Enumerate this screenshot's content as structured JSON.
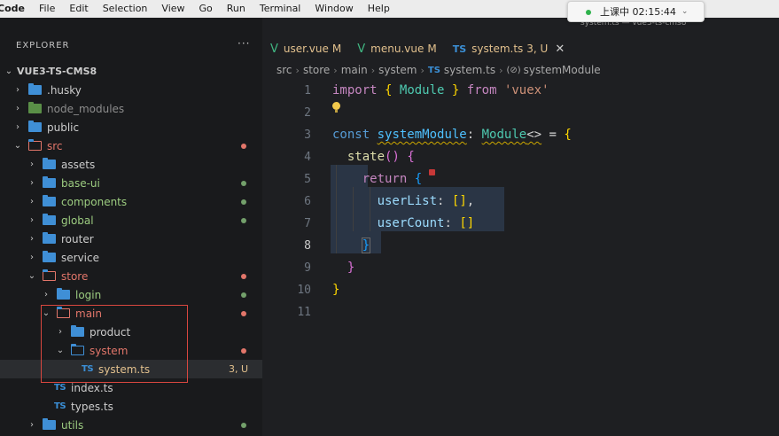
{
  "menubar": {
    "app": "Code",
    "items": [
      "File",
      "Edit",
      "Selection",
      "View",
      "Go",
      "Run",
      "Terminal",
      "Window",
      "Help"
    ]
  },
  "overlay": {
    "text": "上课中 02:15:44"
  },
  "window_title": "system.ts — vue3-ts-cms8",
  "explorer": {
    "header": "EXPLORER",
    "more": "···",
    "root": "VUE3-TS-CMS8",
    "tree": [
      {
        "label": ".husky",
        "status": ""
      },
      {
        "label": "node_modules",
        "status": ""
      },
      {
        "label": "public",
        "status": ""
      },
      {
        "label": "src",
        "status": ""
      },
      {
        "label": "assets",
        "status": ""
      },
      {
        "label": "base-ui",
        "status": ""
      },
      {
        "label": "components",
        "status": ""
      },
      {
        "label": "global",
        "status": ""
      },
      {
        "label": "router",
        "status": ""
      },
      {
        "label": "service",
        "status": ""
      },
      {
        "label": "store",
        "status": ""
      },
      {
        "label": "login",
        "status": ""
      },
      {
        "label": "main",
        "status": ""
      },
      {
        "label": "product",
        "status": ""
      },
      {
        "label": "system",
        "status": ""
      },
      {
        "label": "system.ts",
        "status": "3, U"
      },
      {
        "label": "index.ts",
        "status": ""
      },
      {
        "label": "types.ts",
        "status": ""
      },
      {
        "label": "utils",
        "status": ""
      }
    ],
    "colors": {
      "git_modified": "#e2c08d",
      "git_untracked": "#73c991",
      "git_error": "#e2766a"
    }
  },
  "tabs": [
    {
      "name": "user.vue",
      "flag": "M"
    },
    {
      "name": "menu.vue",
      "flag": "M"
    },
    {
      "name": "system.ts",
      "flag": "3, U"
    }
  ],
  "breadcrumb": [
    "src",
    "store",
    "main",
    "system",
    "system.ts",
    "systemModule"
  ],
  "code": {
    "line_numbers": [
      "1",
      "2",
      "3",
      "4",
      "5",
      "6",
      "7",
      "8",
      "9",
      "10",
      "11"
    ],
    "tokens": {
      "import": "import",
      "lbrace1": "{",
      "Module": "Module",
      "rbrace1": "}",
      "from": "from",
      "vuex": "'vuex'",
      "const": "const",
      "systemModule": "systemModule",
      "colon": ":",
      "Module2": "Module",
      "generic": "<>",
      "eq": "=",
      "lbrace2": "{",
      "state": "state",
      "parens": "()",
      "lbrace3": "{",
      "return": "return",
      "lbrace4": "{",
      "userList": "userList",
      "colon2": ":",
      "arr1": "[]",
      "comma": ",",
      "userCount": "userCount",
      "colon3": ":",
      "arr2": "[]",
      "rbrace4": "}",
      "rbrace3": "}",
      "rbrace2": "}"
    }
  }
}
